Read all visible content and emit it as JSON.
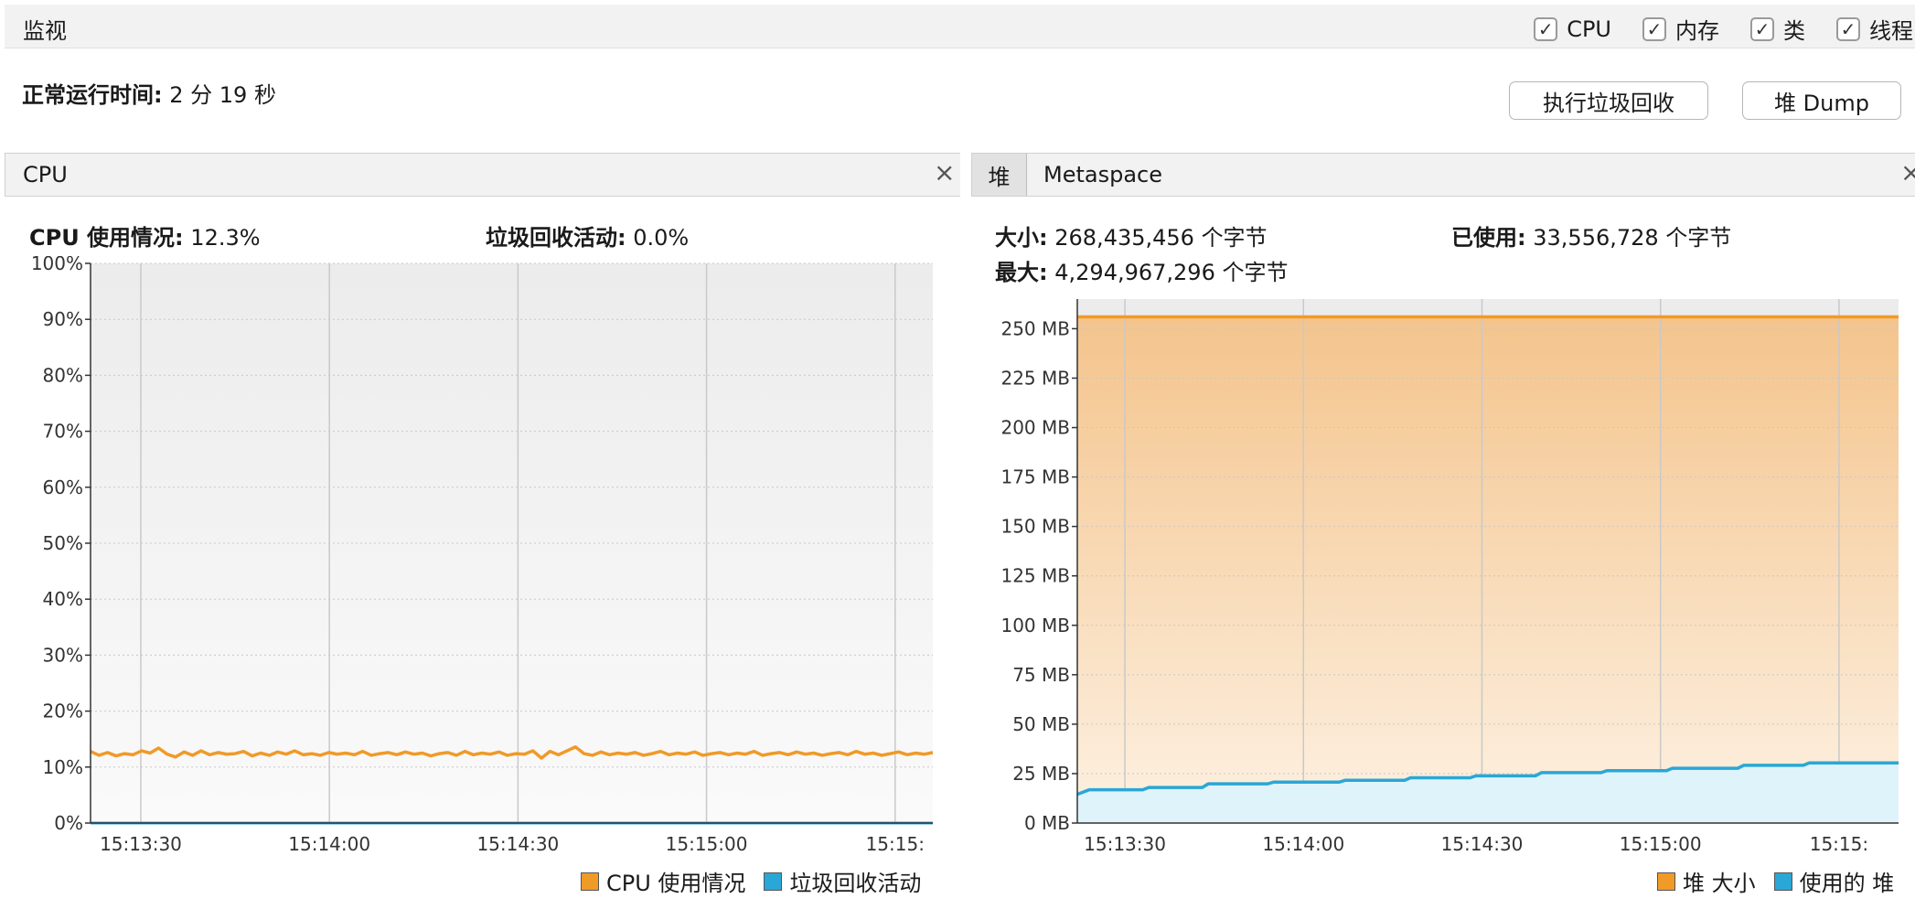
{
  "toolbar": {
    "title": "监视",
    "checkboxes": [
      {
        "label": "CPU",
        "checked": true
      },
      {
        "label": "内存",
        "checked": true
      },
      {
        "label": "类",
        "checked": true
      },
      {
        "label": "线程",
        "checked": true
      }
    ]
  },
  "uptime": {
    "label": "正常运行时间:",
    "value": "2 分 19 秒"
  },
  "buttons": {
    "gc": "执行垃圾回收",
    "dump": "堆 Dump"
  },
  "cpu_panel": {
    "tab": "CPU",
    "usage_label": "CPU 使用情况:",
    "usage_value": "12.3%",
    "gc_label": "垃圾回收活动:",
    "gc_value": "0.0%",
    "legend": [
      {
        "label": "CPU 使用情况",
        "color": "#f09a28"
      },
      {
        "label": "垃圾回收活动",
        "color": "#2aa7d6"
      }
    ]
  },
  "heap_panel": {
    "tabs": [
      "堆",
      "Metaspace"
    ],
    "size_label": "大小:",
    "size_value": "268,435,456 个字节",
    "used_label": "已使用:",
    "used_value": "33,556,728 个字节",
    "max_label": "最大:",
    "max_value": "4,294,967,296 个字节",
    "legend": [
      {
        "label": "堆 大小",
        "color": "#f09a28"
      },
      {
        "label": "使用的 堆",
        "color": "#2aa7d6"
      }
    ]
  },
  "chart_data": [
    {
      "type": "line",
      "x_ticks": [
        "15:13:30",
        "15:14:00",
        "15:14:30",
        "15:15:00",
        "15:15:"
      ],
      "y_ticks": [
        "0%",
        "10%",
        "20%",
        "30%",
        "40%",
        "50%",
        "60%",
        "70%",
        "80%",
        "90%",
        "100%"
      ],
      "ylim": [
        0,
        100
      ],
      "x_range_seconds": [
        0,
        134
      ],
      "grid": true,
      "legend_position": "bottom-right",
      "series": [
        {
          "name": "CPU 使用情况",
          "color": "#f09a28",
          "values": [
            12.8,
            12.1,
            12.6,
            12.0,
            12.4,
            12.2,
            12.9,
            12.5,
            13.4,
            12.3,
            11.8,
            12.7,
            12.1,
            12.9,
            12.2,
            12.6,
            12.3,
            12.4,
            12.8,
            12.0,
            12.5,
            12.1,
            12.7,
            12.3,
            12.9,
            12.2,
            12.4,
            12.1,
            12.6,
            12.3,
            12.5,
            12.2,
            12.8,
            12.1,
            12.4,
            12.6,
            12.2,
            12.7,
            12.3,
            12.5,
            12.0,
            12.4,
            12.6,
            12.1,
            12.8,
            12.2,
            12.5,
            12.3,
            12.7,
            12.1,
            12.4,
            12.3,
            12.9,
            11.6,
            12.8,
            12.2,
            12.9,
            13.6,
            12.4,
            12.1,
            12.7,
            12.2,
            12.5,
            12.3,
            12.6,
            12.1,
            12.4,
            12.8,
            12.2,
            12.5,
            12.3,
            12.7,
            12.1,
            12.4,
            12.6,
            12.2,
            12.5,
            12.3,
            12.8,
            12.1,
            12.4,
            12.6,
            12.2,
            12.7,
            12.3,
            12.5,
            12.1,
            12.4,
            12.6,
            12.2,
            12.8,
            12.3,
            12.5,
            12.1,
            12.4,
            12.7,
            12.2,
            12.5,
            12.3,
            12.6
          ]
        },
        {
          "name": "垃圾回收活动",
          "color": "#2aa7d6",
          "values": [
            0,
            0
          ]
        }
      ]
    },
    {
      "type": "area",
      "x_ticks": [
        "15:13:30",
        "15:14:00",
        "15:14:30",
        "15:15:00",
        "15:15:"
      ],
      "y_ticks": [
        "0 MB",
        "25 MB",
        "50 MB",
        "75 MB",
        "100 MB",
        "125 MB",
        "150 MB",
        "175 MB",
        "200 MB",
        "225 MB",
        "250 MB"
      ],
      "ylim": [
        0,
        265
      ],
      "x_range_seconds": [
        0,
        138
      ],
      "grid": true,
      "legend_position": "bottom-right",
      "series": [
        {
          "name": "堆 大小",
          "color": "#f09a28",
          "points": [
            [
              0,
              256
            ],
            [
              138,
              256
            ]
          ]
        },
        {
          "name": "使用的 堆",
          "color": "#2aa7d6",
          "points": [
            [
              0,
              14.5
            ],
            [
              2,
              16.8
            ],
            [
              11,
              16.8
            ],
            [
              12,
              18.0
            ],
            [
              21,
              18.0
            ],
            [
              22,
              19.8
            ],
            [
              32,
              19.8
            ],
            [
              33,
              20.7
            ],
            [
              44,
              20.7
            ],
            [
              45,
              21.6
            ],
            [
              55,
              21.6
            ],
            [
              56,
              22.9
            ],
            [
              66,
              22.9
            ],
            [
              67,
              23.9
            ],
            [
              77,
              23.9
            ],
            [
              78,
              25.5
            ],
            [
              88,
              25.5
            ],
            [
              89,
              26.5
            ],
            [
              99,
              26.5
            ],
            [
              100,
              27.7
            ],
            [
              111,
              27.7
            ],
            [
              112,
              29.2
            ],
            [
              122,
              29.2
            ],
            [
              123,
              30.4
            ],
            [
              138,
              30.4
            ]
          ]
        }
      ]
    }
  ]
}
